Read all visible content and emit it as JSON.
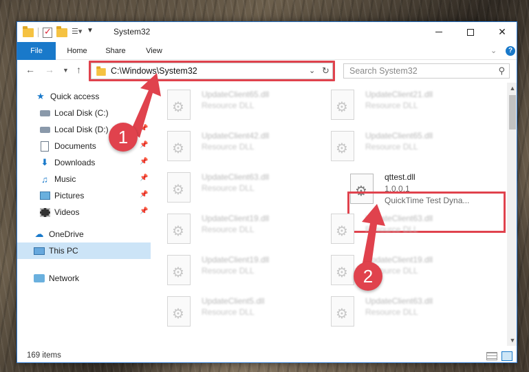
{
  "window": {
    "title": "System32"
  },
  "ribbon": {
    "tabs": [
      "File",
      "Home",
      "Share",
      "View"
    ],
    "help": "?"
  },
  "nav": {
    "address_path": "C:\\Windows\\System32",
    "search_placeholder": "Search System32"
  },
  "sidebar": {
    "items": [
      {
        "label": "Quick access",
        "icon": "star-icon",
        "pinned": false
      },
      {
        "label": "Local Disk (C:)",
        "icon": "disk-icon",
        "pinned": true
      },
      {
        "label": "Local Disk (D:)",
        "icon": "disk-icon",
        "pinned": true
      },
      {
        "label": "Documents",
        "icon": "documents-icon",
        "pinned": true
      },
      {
        "label": "Downloads",
        "icon": "download-icon",
        "pinned": true
      },
      {
        "label": "Music",
        "icon": "music-icon",
        "pinned": true
      },
      {
        "label": "Pictures",
        "icon": "pictures-icon",
        "pinned": true
      },
      {
        "label": "Videos",
        "icon": "videos-icon",
        "pinned": true
      },
      {
        "label": "OneDrive",
        "icon": "cloud-icon",
        "pinned": false
      },
      {
        "label": "This PC",
        "icon": "computer-icon",
        "pinned": false,
        "selected": true
      },
      {
        "label": "Network",
        "icon": "network-icon",
        "pinned": false
      }
    ]
  },
  "files": [
    {
      "name": "UpdateClient65.dll",
      "type": "Resource DLL",
      "blurred": true
    },
    {
      "name": "UpdateClient21.dll",
      "type": "Resource DLL",
      "blurred": true
    },
    {
      "name": "UpdateClient42.dll",
      "type": "Resource DLL",
      "blurred": true
    },
    {
      "name": "UpdateClient65.dll",
      "type": "Resource DLL",
      "blurred": true
    },
    {
      "name": "UpdateClient63.dll",
      "type": "Resource DLL",
      "blurred": true
    },
    {
      "name": "qttest.dll",
      "version": "1.0.0.1",
      "description": "QuickTime Test Dyna...",
      "blurred": false
    },
    {
      "name": "UpdateClient19.dll",
      "type": "Resource DLL",
      "blurred": true
    },
    {
      "name": "UpdateClient63.dll",
      "type": "Resource DLL",
      "blurred": true
    },
    {
      "name": "UpdateClient19.dll",
      "type": "Resource DLL",
      "blurred": true
    },
    {
      "name": "UpdateClient19.dll",
      "type": "Resource DLL",
      "blurred": true
    },
    {
      "name": "UpdateClient5.dll",
      "type": "Resource DLL",
      "blurred": true
    },
    {
      "name": "UpdateClient63.dll",
      "type": "Resource DLL",
      "blurred": true
    }
  ],
  "status": {
    "item_count": "169 items"
  },
  "annotations": {
    "step1": "1",
    "step2": "2",
    "color": "#e0424d"
  }
}
